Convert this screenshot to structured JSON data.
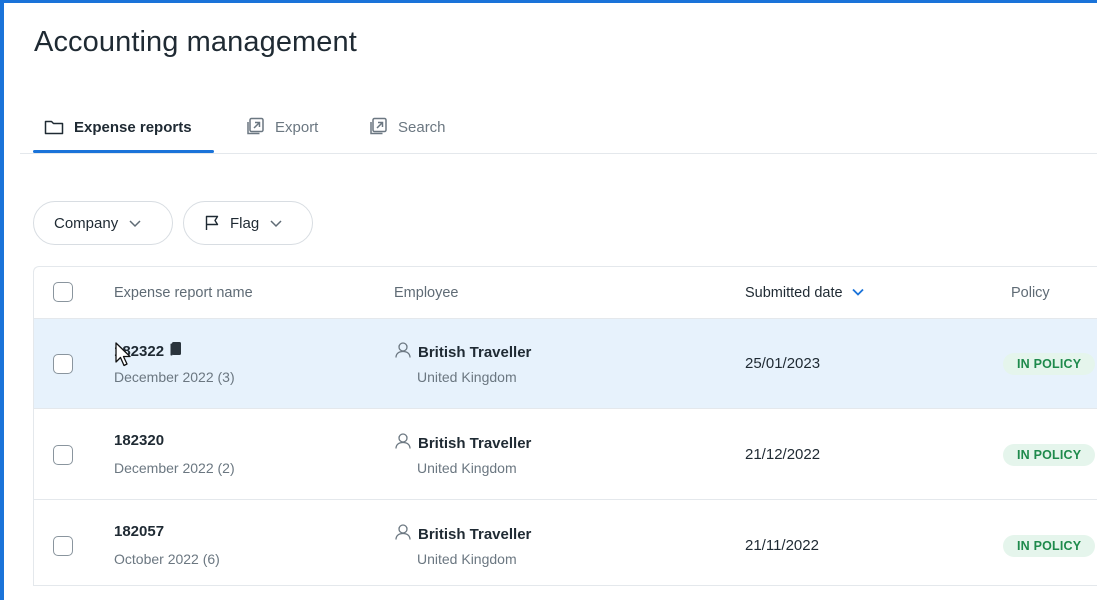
{
  "page": {
    "title": "Accounting management"
  },
  "tabs": [
    {
      "label": "Expense reports",
      "icon": "folder-icon",
      "active": true
    },
    {
      "label": "Export",
      "icon": "external-link-icon",
      "active": false
    },
    {
      "label": "Search",
      "icon": "external-link-icon",
      "active": false
    }
  ],
  "filters": [
    {
      "label": "Company",
      "icon": "chevron-down-icon"
    },
    {
      "label": "Flag",
      "icon": "flag-icon"
    }
  ],
  "table": {
    "columns": {
      "name": "Expense report name",
      "employee": "Employee",
      "submitted": "Submitted date",
      "policy": "Policy"
    },
    "rows": [
      {
        "id": "182322",
        "period": "December 2022 (3)",
        "employee": "British Traveller",
        "country": "United Kingdom",
        "submitted": "25/01/2023",
        "policy": "IN POLICY",
        "has_doc_icon": true
      },
      {
        "id": "182320",
        "period": "December 2022 (2)",
        "employee": "British Traveller",
        "country": "United Kingdom",
        "submitted": "21/12/2022",
        "policy": "IN POLICY",
        "has_doc_icon": false
      },
      {
        "id": "182057",
        "period": "October 2022 (6)",
        "employee": "British Traveller",
        "country": "United Kingdom",
        "submitted": "21/11/2022",
        "policy": "IN POLICY",
        "has_doc_icon": false
      }
    ]
  },
  "colors": {
    "accent": "#1a73d9",
    "row_hover": "#e7f2fc",
    "badge_bg": "#e5f5ec",
    "badge_text": "#1e8a4c"
  }
}
